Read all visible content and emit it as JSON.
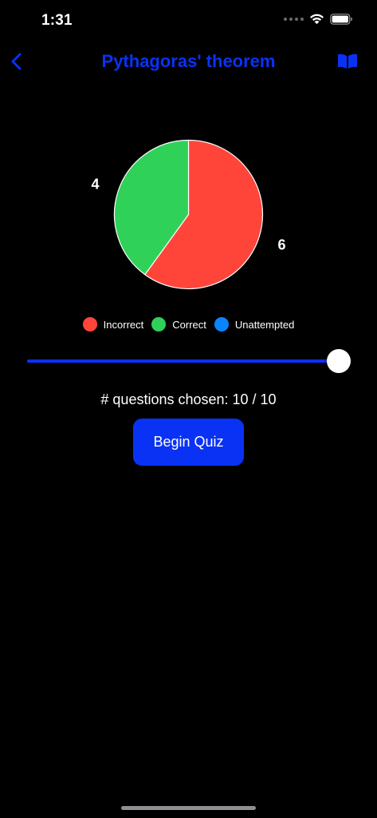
{
  "status_bar": {
    "time": "1:31",
    "icons": [
      "signal-dots-icon",
      "wifi-icon",
      "battery-icon"
    ]
  },
  "nav": {
    "title": "Pythagoras' theorem",
    "back_icon": "chevron-left-icon",
    "right_icon": "book-icon",
    "accent_color": "#0a32f5"
  },
  "chart_data": {
    "type": "pie",
    "categories": [
      "Incorrect",
      "Correct",
      "Unattempted"
    ],
    "values": [
      6,
      4,
      0
    ],
    "colors": [
      "#ff453a",
      "#30d158",
      "#0a84ff"
    ],
    "data_labels": [
      "6",
      "4"
    ],
    "legend_placement": "bottom"
  },
  "legend": {
    "items": [
      {
        "label": "Incorrect",
        "color": "#ff453a"
      },
      {
        "label": "Correct",
        "color": "#30d158"
      },
      {
        "label": "Unattempted",
        "color": "#0a84ff"
      }
    ]
  },
  "slider": {
    "value": 10,
    "max": 10,
    "fill_fraction": 1.0
  },
  "questions": {
    "label": "# questions chosen:  10 / 10"
  },
  "begin_button": {
    "label": "Begin Quiz"
  }
}
